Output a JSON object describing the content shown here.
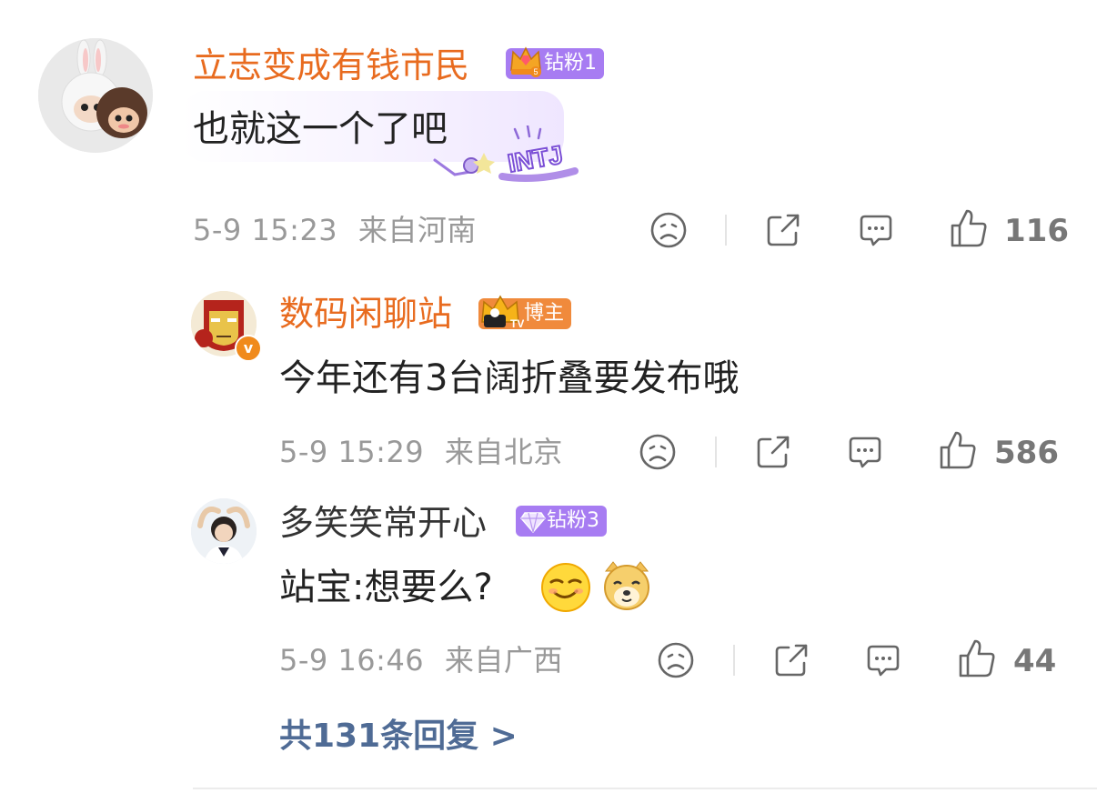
{
  "comment": {
    "username": "立志变成有钱市民",
    "badge": "钻粉1",
    "text": "也就这一个了吧",
    "tag": "INTJ",
    "time": "5-9 15:23",
    "location": "来自河南",
    "likes": "116"
  },
  "replies": [
    {
      "username": "数码闲聊站",
      "badge": "博主",
      "text": "今年还有3台阔折叠要发布哦",
      "time": "5-9 15:29",
      "location": "来自北京",
      "likes": "586"
    },
    {
      "username": "多笑笑常开心",
      "badge": "钻粉3",
      "text": "站宝:想要么?",
      "time": "5-9 16:46",
      "location": "来自广西",
      "likes": "44"
    }
  ],
  "more_replies": "共131条回复 >",
  "colors": {
    "username_orange": "#e86b1f",
    "badge_purple": "#a77cf2",
    "badge_orange": "#f08a3c",
    "link_blue": "#4f6b95"
  }
}
